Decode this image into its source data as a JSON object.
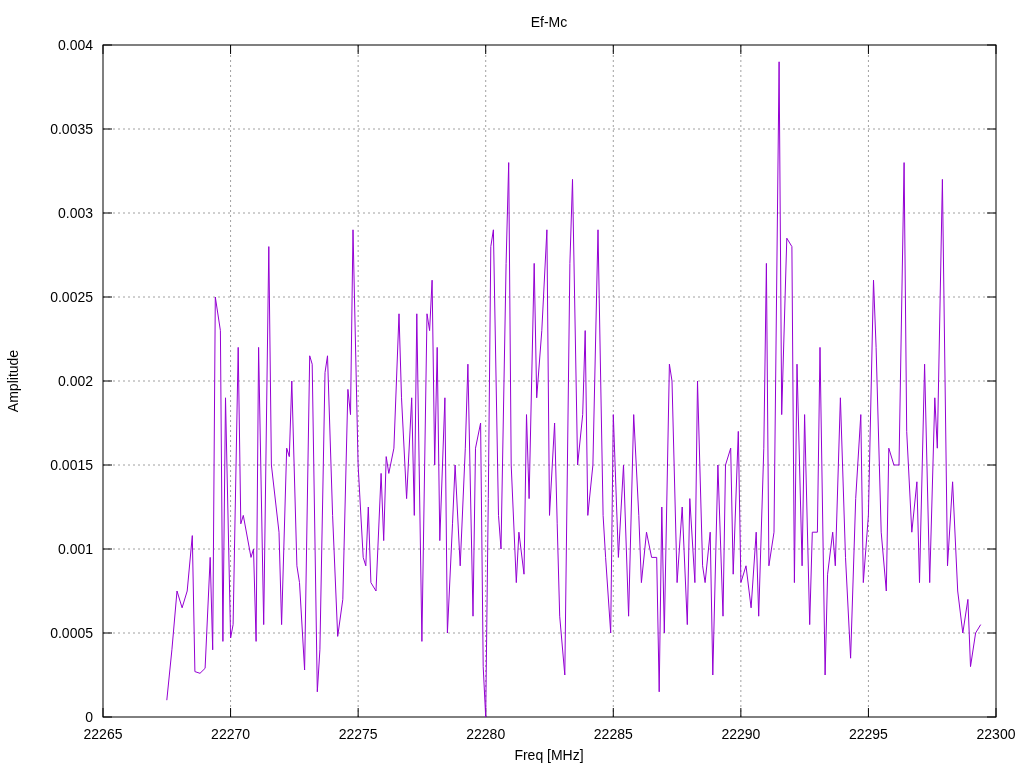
{
  "chart_data": {
    "type": "line",
    "grid": true,
    "title": "Ef-Mc",
    "xlabel": "Freq [MHz]",
    "ylabel": "Amplitude",
    "xlim": [
      22265,
      22300
    ],
    "ylim": [
      0,
      0.004
    ],
    "xticks": [
      22265,
      22270,
      22275,
      22280,
      22285,
      22290,
      22295,
      22300
    ],
    "yticks": [
      0,
      0.0005,
      0.001,
      0.0015,
      0.002,
      0.0025,
      0.003,
      0.0035,
      0.004
    ],
    "x": [
      22267.5,
      22267.7,
      22267.9,
      22268.1,
      22268.3,
      22268.5,
      22268.6,
      22268.8,
      22269.0,
      22269.2,
      22269.3,
      22269.4,
      22269.6,
      22269.7,
      22269.8,
      22270.0,
      22270.1,
      22270.3,
      22270.4,
      22270.5,
      22270.8,
      22270.9,
      22271.0,
      22271.1,
      22271.3,
      22271.5,
      22271.6,
      22271.9,
      22272.0,
      22272.2,
      22272.3,
      22272.4,
      22272.6,
      22272.7,
      22272.9,
      22273.1,
      22273.2,
      22273.4,
      22273.5,
      22273.7,
      22273.8,
      22274.0,
      22274.2,
      22274.4,
      22274.6,
      22274.7,
      22274.8,
      22275.0,
      22275.2,
      22275.3,
      22275.4,
      22275.5,
      22275.7,
      22275.9,
      22276.0,
      22276.1,
      22276.2,
      22276.4,
      22276.6,
      22276.7,
      22276.9,
      22277.1,
      22277.2,
      22277.3,
      22277.5,
      22277.7,
      22277.8,
      22277.9,
      22278.0,
      22278.1,
      22278.2,
      22278.4,
      22278.5,
      22278.7,
      22278.8,
      22279.0,
      22279.2,
      22279.3,
      22279.5,
      22279.6,
      22279.8,
      22279.9,
      22280.0,
      22280.1,
      22280.2,
      22280.3,
      22280.5,
      22280.6,
      22280.8,
      22280.9,
      22281.0,
      22281.2,
      22281.3,
      22281.5,
      22281.6,
      22281.7,
      22281.9,
      22282.0,
      22282.2,
      22282.4,
      22282.5,
      22282.7,
      22282.8,
      22282.9,
      22283.1,
      22283.3,
      22283.4,
      22283.6,
      22283.8,
      22283.9,
      22284.0,
      22284.2,
      22284.4,
      22284.6,
      22284.7,
      22284.9,
      22285.0,
      22285.2,
      22285.4,
      22285.6,
      22285.8,
      22286.0,
      22286.1,
      22286.3,
      22286.5,
      22286.7,
      22286.8,
      22286.9,
      22287.0,
      22287.2,
      22287.3,
      22287.5,
      22287.7,
      22287.9,
      22288.0,
      22288.2,
      22288.3,
      22288.5,
      22288.6,
      22288.8,
      22288.9,
      22289.1,
      22289.3,
      22289.4,
      22289.6,
      22289.7,
      22289.9,
      22290.0,
      22290.2,
      22290.4,
      22290.6,
      22290.7,
      22290.9,
      22291.0,
      22291.1,
      22291.3,
      22291.5,
      22291.6,
      22291.8,
      22292.0,
      22292.1,
      22292.2,
      22292.4,
      22292.5,
      22292.7,
      22292.8,
      22293.0,
      22293.1,
      22293.3,
      22293.4,
      22293.6,
      22293.7,
      22293.9,
      22294.1,
      22294.3,
      22294.5,
      22294.7,
      22294.8,
      22295.0,
      22295.2,
      22295.3,
      22295.5,
      22295.7,
      22295.8,
      22296.0,
      22296.2,
      22296.4,
      22296.5,
      22296.7,
      22296.9,
      22297.0,
      22297.2,
      22297.4,
      22297.6,
      22297.7,
      22297.9,
      22298.1,
      22298.3,
      22298.5,
      22298.7,
      22298.9,
      22299.0,
      22299.2,
      22299.4
    ],
    "series": [
      {
        "color": "#9400d3",
        "values": [
          0.0001,
          0.0004,
          0.00075,
          0.00065,
          0.00075,
          0.00108,
          0.00027,
          0.00026,
          0.00029,
          0.00095,
          0.0004,
          0.0025,
          0.0023,
          0.00045,
          0.0019,
          0.00047,
          0.00055,
          0.0022,
          0.00115,
          0.0012,
          0.00095,
          0.001,
          0.00045,
          0.0022,
          0.00055,
          0.0028,
          0.0015,
          0.0011,
          0.00055,
          0.0016,
          0.00155,
          0.002,
          0.0009,
          0.0008,
          0.00028,
          0.00215,
          0.0021,
          0.00015,
          0.0004,
          0.00205,
          0.00215,
          0.0012,
          0.00048,
          0.0007,
          0.00195,
          0.0018,
          0.0029,
          0.0015,
          0.00095,
          0.0009,
          0.00125,
          0.0008,
          0.00075,
          0.00145,
          0.00105,
          0.00155,
          0.00145,
          0.0016,
          0.0024,
          0.0019,
          0.0013,
          0.0019,
          0.0012,
          0.0024,
          0.00045,
          0.0024,
          0.0023,
          0.0026,
          0.0015,
          0.0022,
          0.00105,
          0.0019,
          0.0005,
          0.00115,
          0.0015,
          0.0009,
          0.0016,
          0.0021,
          0.0006,
          0.0016,
          0.00175,
          0.0003,
          0,
          0.0013,
          0.0028,
          0.0029,
          0.0012,
          0.001,
          0.0027,
          0.0033,
          0.0015,
          0.0008,
          0.0011,
          0.00085,
          0.0018,
          0.0013,
          0.0027,
          0.0019,
          0.0023,
          0.0029,
          0.0012,
          0.00175,
          0.00115,
          0.0006,
          0.00025,
          0.0027,
          0.0032,
          0.0015,
          0.0018,
          0.0023,
          0.0012,
          0.0015,
          0.0029,
          0.0012,
          0.00095,
          0.0005,
          0.0018,
          0.00095,
          0.0015,
          0.0006,
          0.0018,
          0.0012,
          0.0008,
          0.0011,
          0.00095,
          0.00095,
          0.00015,
          0.00125,
          0.0005,
          0.0021,
          0.002,
          0.0008,
          0.00125,
          0.00055,
          0.0013,
          0.0008,
          0.002,
          0.0009,
          0.0008,
          0.0011,
          0.00025,
          0.0015,
          0.0006,
          0.0015,
          0.0016,
          0.00085,
          0.0017,
          0.0008,
          0.0009,
          0.00065,
          0.0011,
          0.0006,
          0.0016,
          0.0027,
          0.0009,
          0.0011,
          0.0039,
          0.0018,
          0.00285,
          0.0028,
          0.0008,
          0.0021,
          0.0009,
          0.0018,
          0.00055,
          0.0011,
          0.0011,
          0.0022,
          0.00025,
          0.00085,
          0.0011,
          0.0009,
          0.0019,
          0.00095,
          0.00035,
          0.0013,
          0.0018,
          0.0008,
          0.0012,
          0.0026,
          0.0022,
          0.0011,
          0.00075,
          0.0016,
          0.0015,
          0.0015,
          0.0033,
          0.0017,
          0.0011,
          0.0014,
          0.0008,
          0.0021,
          0.0008,
          0.0019,
          0.0016,
          0.0032,
          0.0009,
          0.0014,
          0.00075,
          0.0005,
          0.0007,
          0.0003,
          0.0005,
          0.00055
        ]
      }
    ]
  }
}
